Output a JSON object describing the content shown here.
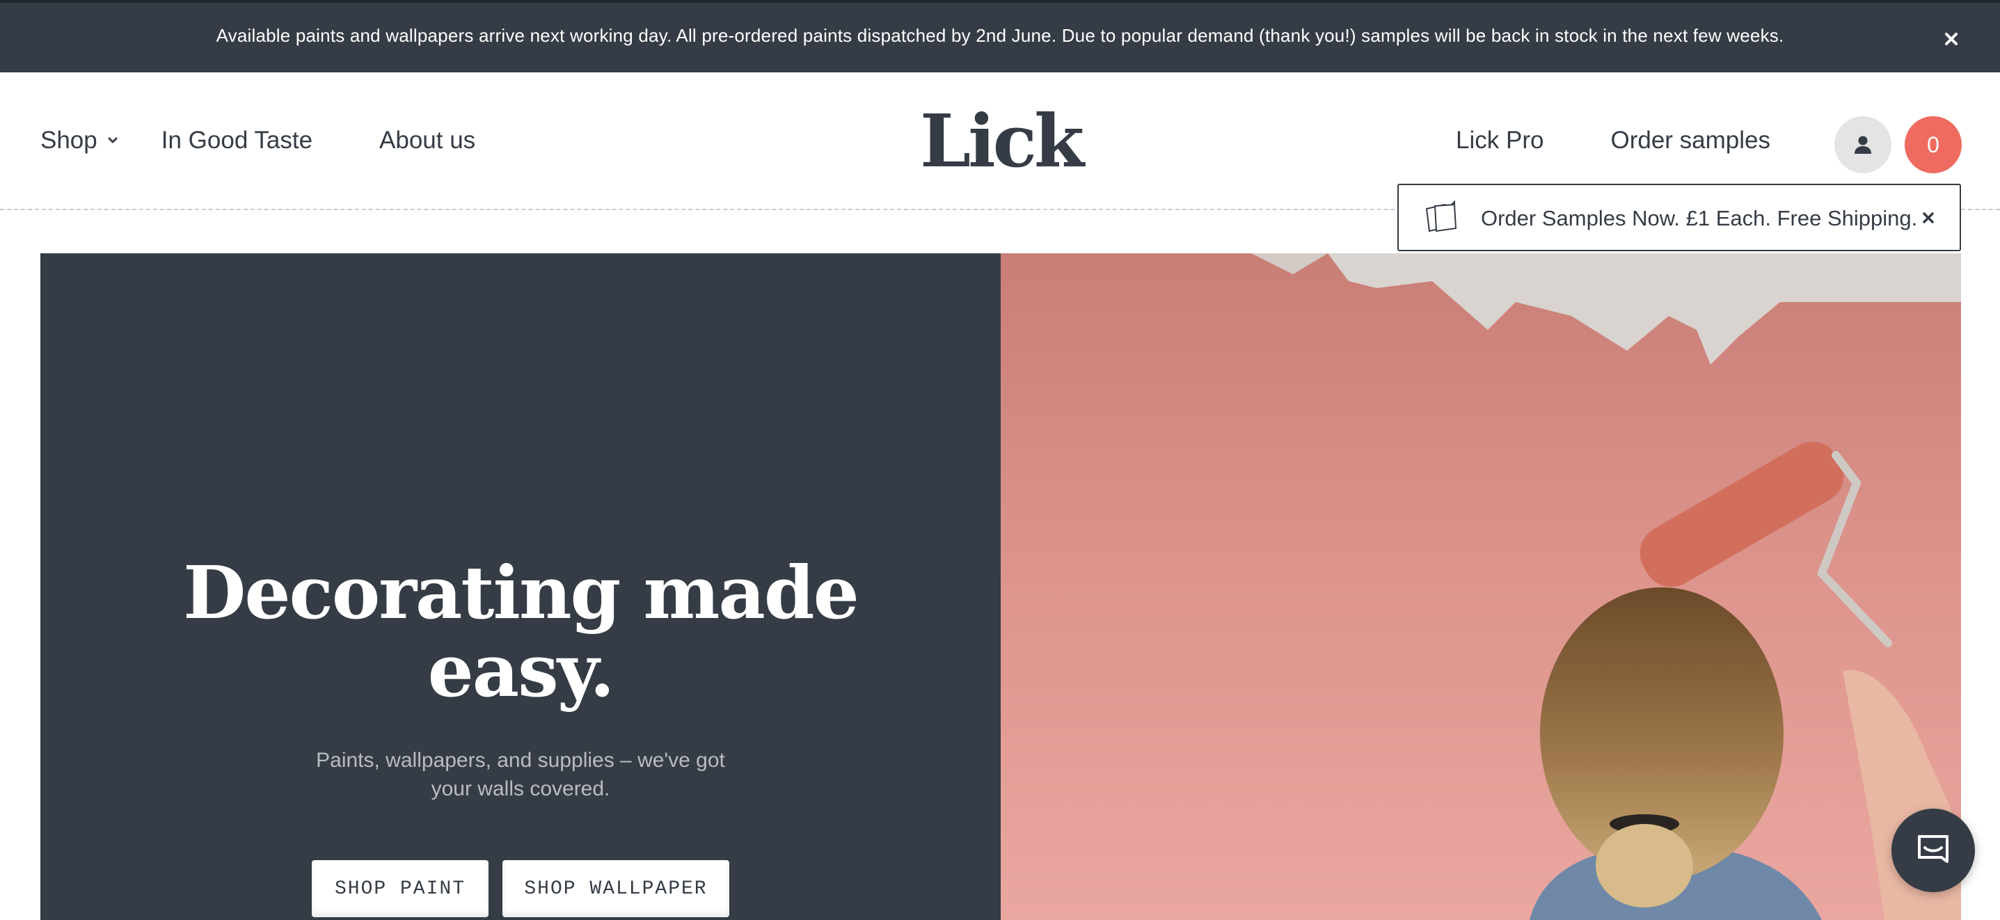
{
  "announcement": {
    "text": "Available paints and wallpapers arrive next working day. All pre-ordered paints dispatched by 2nd June. Due to popular demand (thank you!) samples will be back in stock in the next few weeks.",
    "close_icon": "close-icon"
  },
  "header": {
    "logo": "Lick",
    "nav_left": [
      {
        "label": "Shop",
        "has_dropdown": true
      },
      {
        "label": "In Good Taste"
      },
      {
        "label": "About us"
      }
    ],
    "nav_right": [
      {
        "label": "Lick Pro"
      },
      {
        "label": "Order samples"
      }
    ],
    "account_icon": "user-icon",
    "cart_count": "0"
  },
  "samples_popup": {
    "icon": "samples-cards-icon",
    "text": "Order Samples Now. £1 Each. Free Shipping."
  },
  "hero": {
    "title_line1": "Decorating made",
    "title_line2": "easy.",
    "subtitle": "Paints, wallpapers, and supplies – we've got your walls covered.",
    "buttons": [
      "SHOP PAINT",
      "SHOP WALLPAPER"
    ]
  },
  "chat": {
    "icon": "chat-icon"
  },
  "colors": {
    "dark": "#353c45",
    "accent": "#ef6b5f",
    "pink_wall": "#e3968f",
    "muted_text": "#b9bcc0"
  }
}
